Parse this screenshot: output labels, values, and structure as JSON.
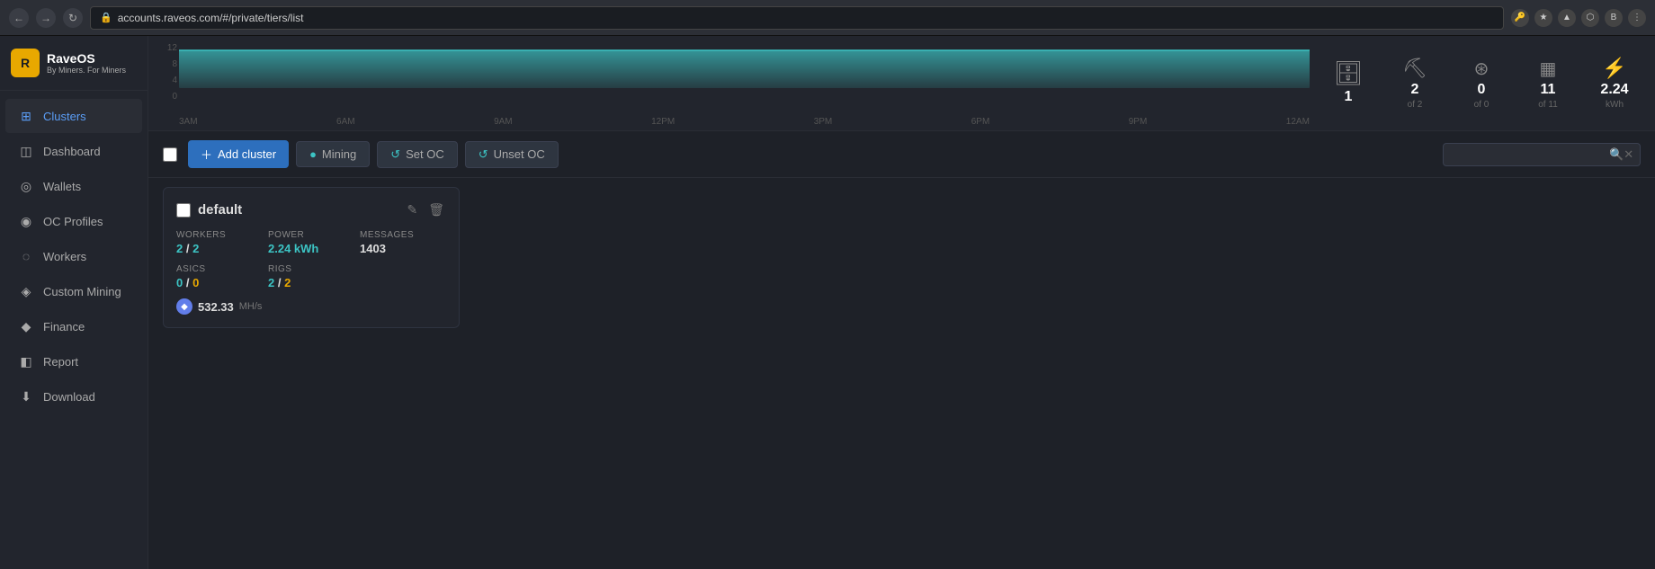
{
  "browser": {
    "url": "accounts.raveos.com/#/private/tiers/list",
    "back_btn": "←",
    "forward_btn": "→",
    "reload_btn": "↻"
  },
  "logo": {
    "title": "RaveOS",
    "subtitle_line1": "By Miners.",
    "subtitle_line2": "For Miners"
  },
  "sidebar": {
    "items": [
      {
        "id": "clusters",
        "label": "Clusters",
        "icon": "⊞",
        "active": true
      },
      {
        "id": "dashboard",
        "label": "Dashboard",
        "icon": "◫"
      },
      {
        "id": "wallets",
        "label": "Wallets",
        "icon": "◎"
      },
      {
        "id": "oc-profiles",
        "label": "OC Profiles",
        "icon": "◉"
      },
      {
        "id": "workers",
        "label": "Workers",
        "icon": "◌"
      },
      {
        "id": "custom-mining",
        "label": "Custom Mining",
        "icon": "◈"
      },
      {
        "id": "finance",
        "label": "Finance",
        "icon": "◆"
      },
      {
        "id": "report",
        "label": "Report",
        "icon": "◧"
      },
      {
        "id": "download",
        "label": "Download",
        "icon": "⬇"
      }
    ]
  },
  "chart": {
    "y_labels": [
      "12",
      "8",
      "4",
      "0"
    ],
    "x_labels": [
      "3AM",
      "6AM",
      "9AM",
      "12PM",
      "3PM",
      "6PM",
      "9PM",
      "12AM"
    ],
    "bar_color": "#3cc4c4"
  },
  "stats": [
    {
      "id": "clusters",
      "icon": "🗄",
      "value": "1",
      "sub": ""
    },
    {
      "id": "workers",
      "icon": "⛏",
      "value": "2",
      "sub": "of 2"
    },
    {
      "id": "asics",
      "icon": "⊛",
      "value": "0",
      "sub": "of 0"
    },
    {
      "id": "rigs",
      "icon": "▦",
      "value": "11",
      "sub": "of 11"
    },
    {
      "id": "power",
      "icon": "⚡",
      "value": "2.24",
      "sub": "kWh"
    }
  ],
  "toolbar": {
    "add_cluster_label": "Add cluster",
    "mining_label": "Mining",
    "set_oc_label": "Set OC",
    "unset_oc_label": "Unset OC",
    "search_placeholder": ""
  },
  "cluster": {
    "name": "default",
    "workers_label": "WORKERS",
    "workers_value": "2 / 2",
    "workers_online": "2",
    "workers_sep": " / ",
    "workers_total": "2",
    "power_label": "POWER",
    "power_value": "2.24 kWh",
    "messages_label": "MESSAGES",
    "messages_value": "1403",
    "asics_label": "ASICS",
    "asics_value": "0 / 0",
    "rigs_label": "RIGS",
    "rigs_value": "2 / 2",
    "hashrate": "532.33",
    "hashrate_unit": "MH/s"
  }
}
